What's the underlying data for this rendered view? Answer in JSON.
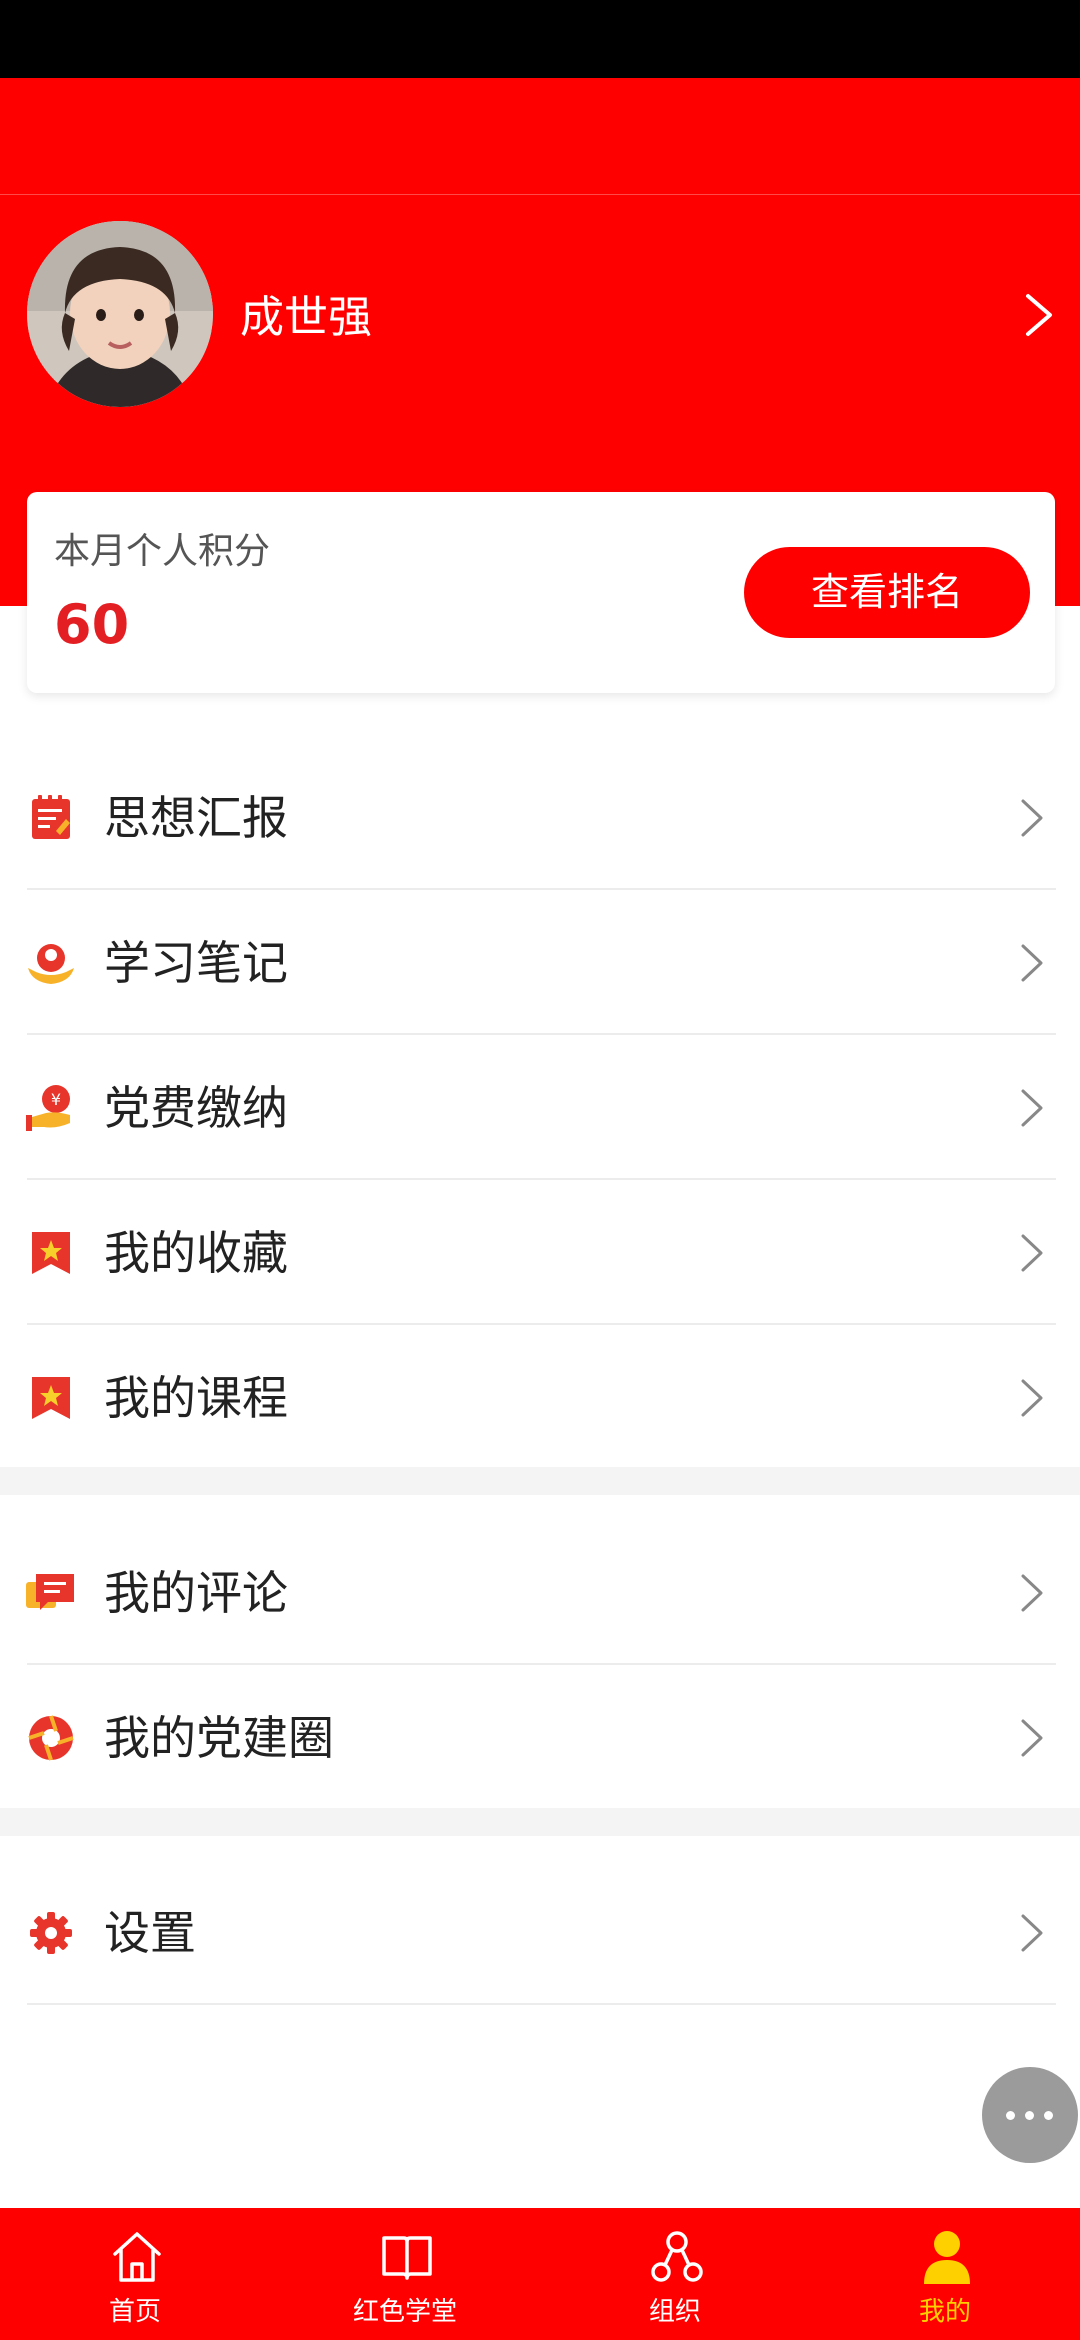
{
  "profile": {
    "name": "成世强"
  },
  "score": {
    "label": "本月个人积分",
    "value": "60",
    "button_label": "查看排名"
  },
  "menu": {
    "group1": [
      {
        "label": "思想汇报",
        "icon": "report-icon"
      },
      {
        "label": "学习笔记",
        "icon": "study-notes-icon"
      },
      {
        "label": "党费缴纳",
        "icon": "fee-payment-icon"
      },
      {
        "label": "我的收藏",
        "icon": "favorites-bookmark-icon"
      },
      {
        "label": "我的课程",
        "icon": "courses-bookmark-icon"
      }
    ],
    "group2": [
      {
        "label": "我的评论",
        "icon": "comment-icon"
      },
      {
        "label": "我的党建圈",
        "icon": "circle-aperture-icon"
      }
    ],
    "group3": [
      {
        "label": "设置",
        "icon": "gear-icon"
      }
    ]
  },
  "tabbar": {
    "items": [
      {
        "label": "首页",
        "icon": "home-icon"
      },
      {
        "label": "红色学堂",
        "icon": "book-icon"
      },
      {
        "label": "组织",
        "icon": "organization-icon"
      },
      {
        "label": "我的",
        "icon": "user-icon"
      }
    ],
    "active_index": 3
  },
  "colors": {
    "primary_red": "#ff0000",
    "score_red": "#e41f24",
    "active_tab": "#ffd000",
    "icon_red": "#e8352b",
    "icon_yellow": "#f8b22a"
  }
}
